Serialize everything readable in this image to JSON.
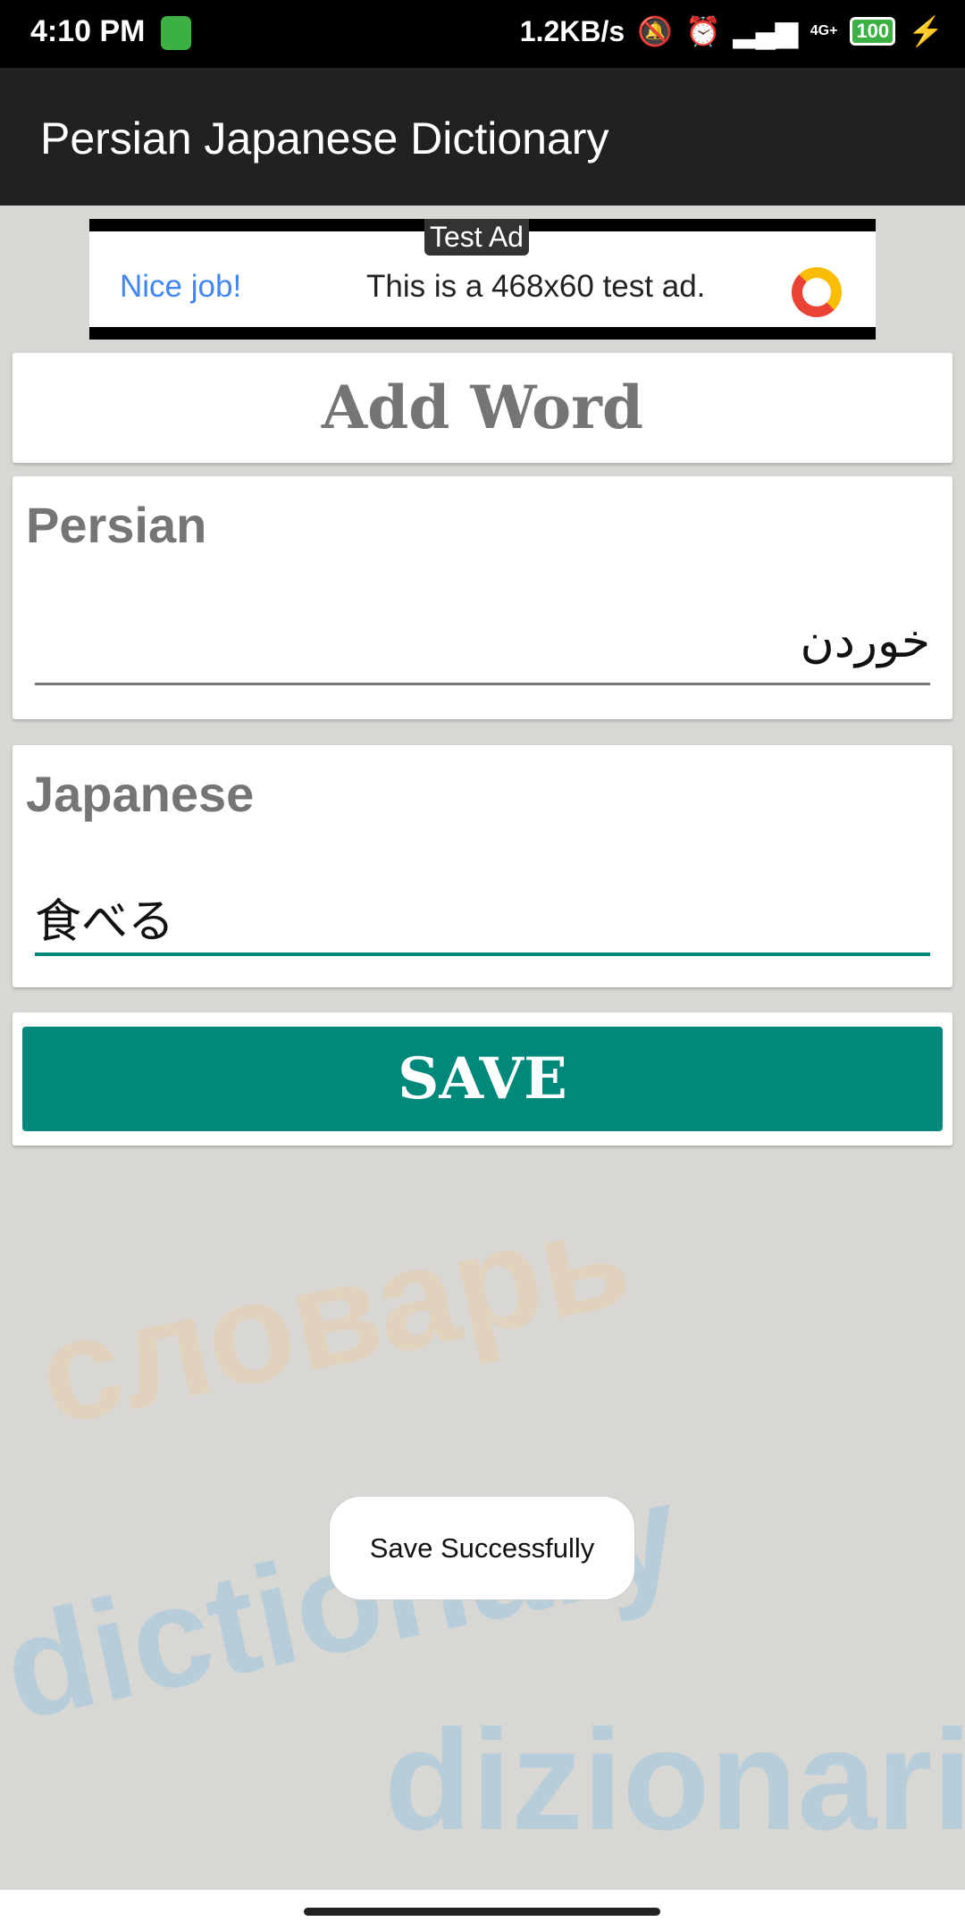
{
  "status_bar": {
    "time": "4:10 PM",
    "net_speed": "1.2KB/s",
    "battery": "100",
    "network": "4G+",
    "icons": [
      "app-icon",
      "bell-off-icon",
      "alarm-icon",
      "signal-icon",
      "signal-4g-icon",
      "battery-icon",
      "charging-icon"
    ]
  },
  "app_bar": {
    "title": "Persian Japanese Dictionary"
  },
  "ad": {
    "tag": "Test Ad",
    "headline": "Nice job!",
    "message": "This is a 468x60 test ad."
  },
  "form": {
    "heading": "Add Word",
    "persian_label": "Persian",
    "persian_value": "خوردن",
    "japanese_label": "Japanese",
    "japanese_value": "食べる",
    "save_label": "SAVE"
  },
  "toast": "Save Successfully",
  "colors": {
    "accent": "#00897b",
    "app_bar": "#212121"
  }
}
